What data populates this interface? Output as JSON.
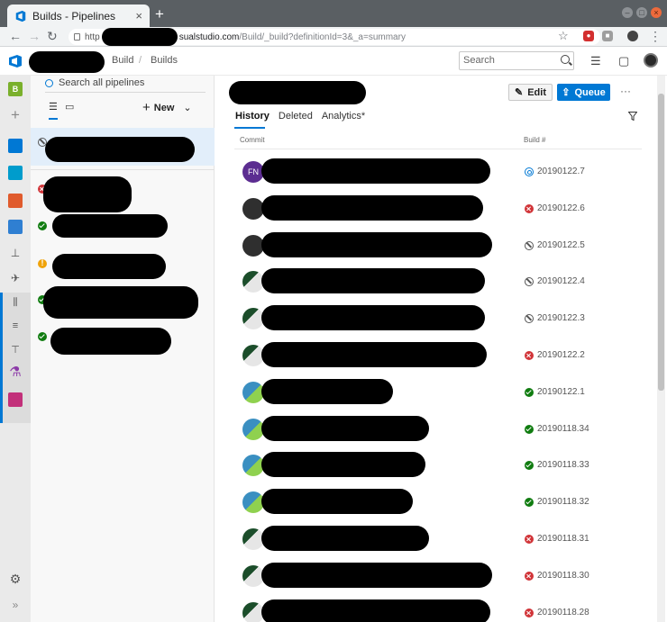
{
  "browser": {
    "tab_title": "Builds - Pipelines",
    "url_host": "sualstudio.com",
    "url_path": "/Build/_build?definitionId=3&_a=summary",
    "url_scheme": "http"
  },
  "header": {
    "breadcrumbs": [
      "Build",
      "Builds"
    ],
    "search_placeholder": "Search"
  },
  "leftnav": {
    "project_initial": "B"
  },
  "pipelines": {
    "search_label": "Search all pipelines",
    "new_label": "New",
    "items": [
      {
        "status": "canceled"
      },
      {
        "status": "failed"
      },
      {
        "status": "success"
      },
      {
        "status": "warning"
      },
      {
        "status": "success"
      },
      {
        "status": "success"
      }
    ]
  },
  "main": {
    "edit_label": "Edit",
    "queue_label": "Queue",
    "more_label": "···",
    "tabs": [
      "History",
      "Deleted",
      "Analytics*"
    ],
    "col_commit": "Commit",
    "col_build": "Build #",
    "rows": [
      {
        "avatar_text": "FN",
        "avatar": "fn",
        "status": "running",
        "build": "20190122.7"
      },
      {
        "avatar_text": "",
        "avatar": "dark",
        "status": "failed",
        "build": "20190122.6"
      },
      {
        "avatar_text": "",
        "avatar": "dark",
        "status": "canceled",
        "build": "20190122.5"
      },
      {
        "avatar_text": "",
        "avatar": "green",
        "status": "canceled",
        "build": "20190122.4"
      },
      {
        "avatar_text": "",
        "avatar": "green",
        "status": "canceled",
        "build": "20190122.3"
      },
      {
        "avatar_text": "",
        "avatar": "green",
        "status": "failed",
        "build": "20190122.2"
      },
      {
        "avatar_text": "",
        "avatar": "blue",
        "status": "success",
        "build": "20190122.1"
      },
      {
        "avatar_text": "",
        "avatar": "blue",
        "status": "success",
        "build": "20190118.34"
      },
      {
        "avatar_text": "",
        "avatar": "blue",
        "status": "success",
        "build": "20190118.33"
      },
      {
        "avatar_text": "",
        "avatar": "blue",
        "status": "success",
        "build": "20190118.32"
      },
      {
        "avatar_text": "",
        "avatar": "green",
        "status": "failed",
        "build": "20190118.31"
      },
      {
        "avatar_text": "",
        "avatar": "green",
        "status": "failed",
        "build": "20190118.30"
      },
      {
        "avatar_text": "",
        "avatar": "green",
        "status": "failed",
        "build": "20190118.28"
      }
    ]
  },
  "colors": {
    "accent": "#0078d4",
    "success": "#107c10",
    "failed": "#d13438",
    "warning": "#f0a30a"
  }
}
